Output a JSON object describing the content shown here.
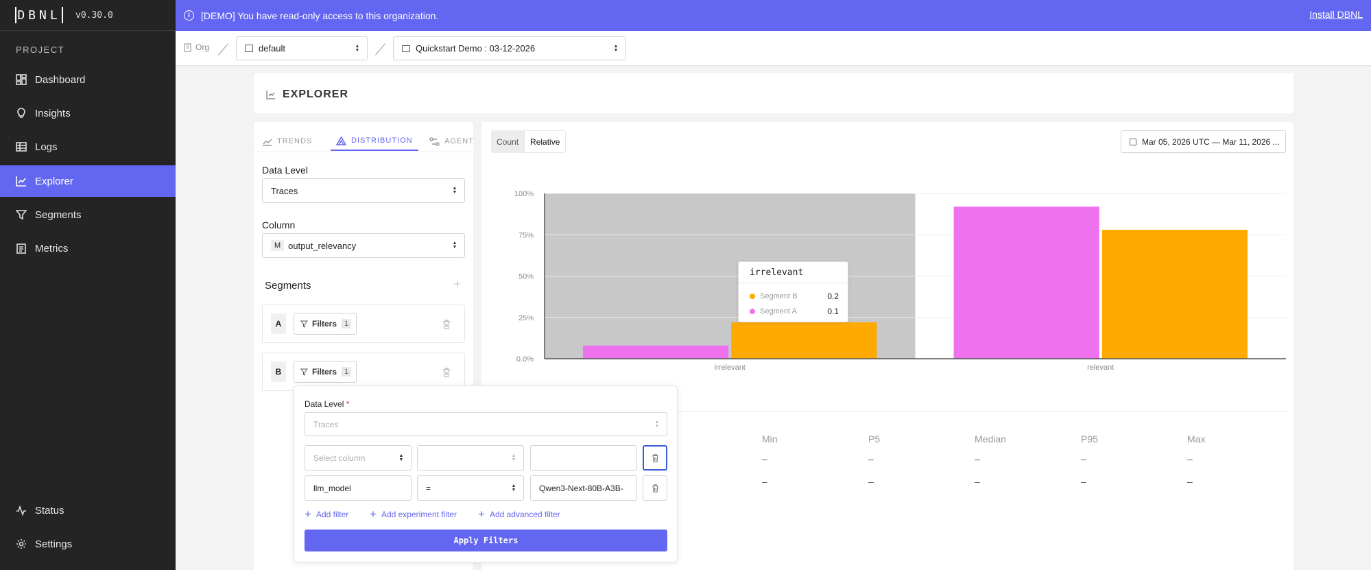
{
  "app": {
    "version": "v0.30.0",
    "logo": "DBNL"
  },
  "banner": {
    "message": "[DEMO] You have read-only access to this organization.",
    "install_link": "Install DBNL",
    "color": "#6366f1"
  },
  "sidebar": {
    "section_label": "PROJECT",
    "items": [
      {
        "label": "Dashboard",
        "icon": "dashboard-icon"
      },
      {
        "label": "Insights",
        "icon": "lightbulb-icon"
      },
      {
        "label": "Logs",
        "icon": "table-icon"
      },
      {
        "label": "Explorer",
        "icon": "chart-line-icon",
        "active": true
      },
      {
        "label": "Segments",
        "icon": "filter-icon"
      },
      {
        "label": "Metrics",
        "icon": "clipboard-icon"
      }
    ],
    "bottom_items": [
      {
        "label": "Status",
        "icon": "activity-icon"
      },
      {
        "label": "Settings",
        "icon": "gear-icon"
      }
    ]
  },
  "breadcrumb": {
    "org": "Org",
    "namespace": "default",
    "project": "Quickstart Demo : 03-12-2026"
  },
  "page": {
    "title": "EXPLORER"
  },
  "left_panel": {
    "tabs": [
      {
        "label": "TRENDS"
      },
      {
        "label": "DISTRIBUTION",
        "active": true
      },
      {
        "label": "AGENT"
      }
    ],
    "data_level_label": "Data Level",
    "data_level_value": "Traces",
    "column_label": "Column",
    "column_type_badge": "M",
    "column_value": "output_relevancy",
    "segments_label": "Segments",
    "segments": [
      {
        "letter": "A",
        "filters_label": "Filters",
        "filters_count": "1"
      },
      {
        "letter": "B",
        "filters_label": "Filters",
        "filters_count": "1"
      }
    ]
  },
  "filter_popover": {
    "data_level_label": "Data Level",
    "required_mark": "*",
    "data_level_placeholder": "Traces",
    "rows": [
      {
        "column": "Select column",
        "column_placeholder": true,
        "operator": "",
        "value": ""
      },
      {
        "column": "llm_model",
        "column_placeholder": false,
        "operator": "=",
        "value": "Qwen3-Next-80B-A3B-"
      }
    ],
    "add_filter": "Add filter",
    "add_experiment_filter": "Add experiment filter",
    "add_advanced_filter": "Add advanced filter",
    "apply_button": "Apply Filters"
  },
  "chart_controls": {
    "count_label": "Count",
    "relative_label": "Relative",
    "date_range": "Mar 05, 2026 UTC — Mar 11, 2026 ..."
  },
  "chart_data": {
    "type": "bar",
    "categories": [
      "irrelevant",
      "relevant"
    ],
    "ylim": [
      0,
      1
    ],
    "yticks": [
      "0.0%",
      "25%",
      "50%",
      "75%",
      "100%"
    ],
    "highlighted_category": "irrelevant",
    "series": [
      {
        "name": "Segment A",
        "color": "#ee72ee",
        "values": [
          0.08,
          0.92
        ]
      },
      {
        "name": "Segment B",
        "color": "#ffaa00",
        "values": [
          0.22,
          0.78
        ]
      }
    ],
    "tooltip": {
      "title": "irrelevant",
      "rows": [
        {
          "name": "Segment B",
          "value": "0.2",
          "color": "#ffaa00"
        },
        {
          "name": "Segment A",
          "value": "0.1",
          "color": "#ee72ee"
        }
      ]
    }
  },
  "stats": {
    "headers": [
      "Min",
      "P5",
      "Median",
      "P95",
      "Max"
    ],
    "rows": [
      [
        "–",
        "–",
        "–",
        "–",
        "–"
      ],
      [
        "–",
        "–",
        "–",
        "–",
        "–"
      ]
    ]
  }
}
